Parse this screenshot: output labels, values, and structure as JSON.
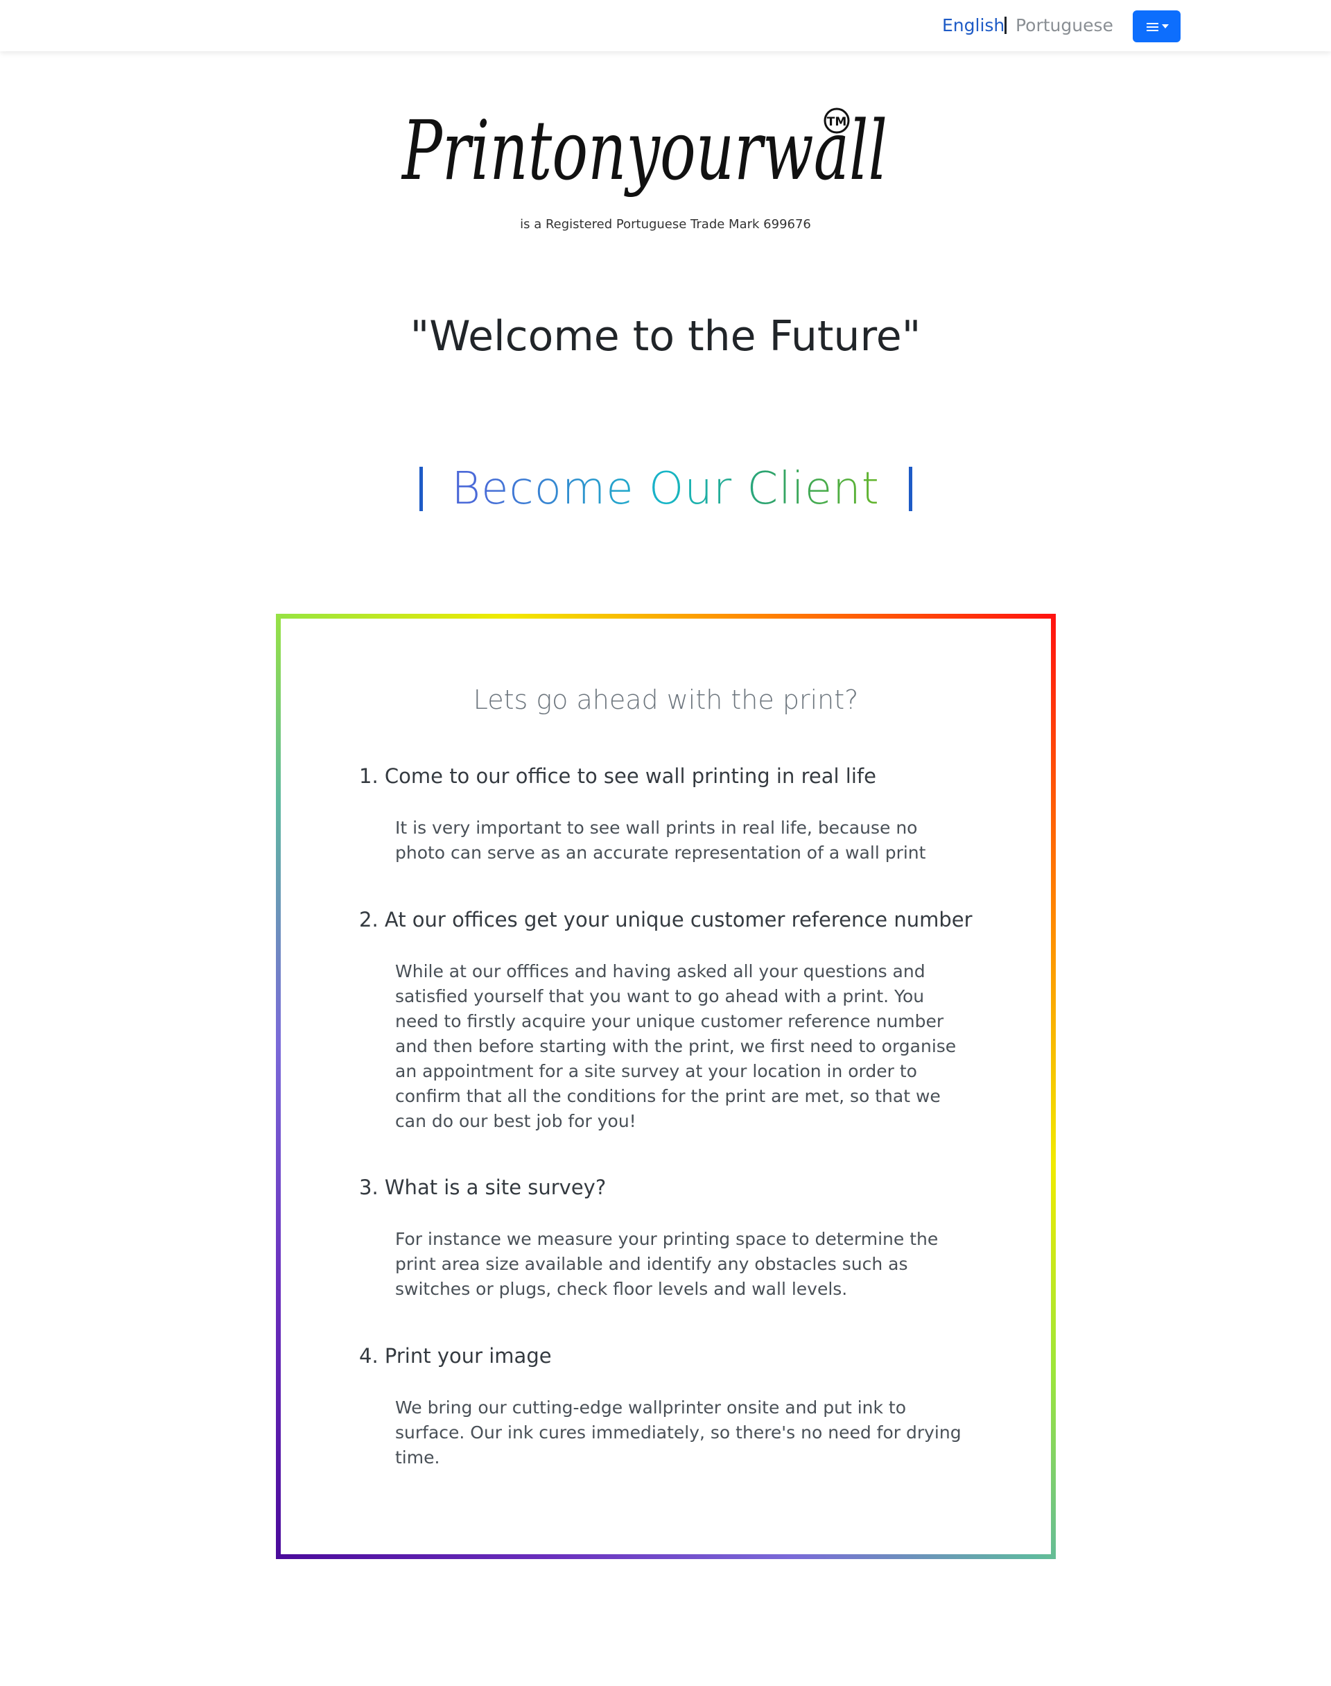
{
  "nav": {
    "lang_english": "English",
    "lang_portuguese": "Portuguese",
    "menu_icon": "hamburger-menu-icon",
    "accent_color": "#0d6efd",
    "link_color": "#1e5bc6"
  },
  "logo": {
    "wordmark": "Printonyourwall",
    "trademark": "TM",
    "subtitle": "is a Registered Portuguese Trade Mark 699676"
  },
  "welcome": "\"Welcome to the Future\"",
  "become_client": {
    "words": [
      "Become",
      "Our",
      "Client"
    ]
  },
  "box": {
    "title": "Lets go ahead with the print?",
    "steps": [
      {
        "title": "1. Come to our office to see wall printing in real life",
        "body": "It is very important to see wall prints in real life, because no photo can serve as an accurate representation of a wall print"
      },
      {
        "title": "2. At our offices get your unique customer reference number",
        "body": "While at our offfices and having asked all your questions and satisfied yourself that you want to go ahead with a print. You need to firstly acquire your unique customer reference number and then before starting with the print, we first need to organise an appointment for a site survey at your location in order to confirm that all the conditions for the print are met, so that we can do our best job for you!"
      },
      {
        "title": "3. What is a site survey?",
        "body": "For instance we measure your printing space to determine the print area size available and identify any obstacles such as switches or plugs, check floor levels and wall levels."
      },
      {
        "title": "4. Print your image",
        "body": "We bring our cutting-edge wallprinter onsite and put ink to surface. Our ink cures immediately, so there's no need for drying time."
      }
    ]
  }
}
